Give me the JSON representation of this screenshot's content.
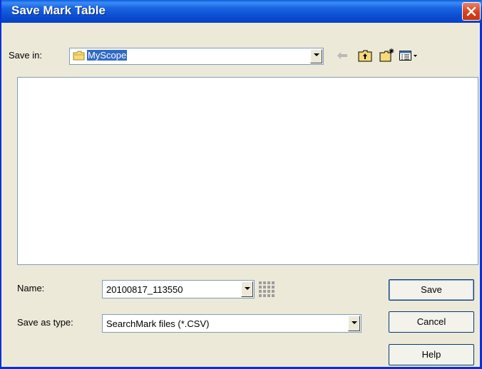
{
  "dialog": {
    "title": "Save Mark Table"
  },
  "toolbar": {
    "save_in_label": "Save in:",
    "save_in_value": "MyScope",
    "icons": [
      "back-arrow-icon",
      "up-one-level-icon",
      "new-folder-icon",
      "view-menu-icon"
    ]
  },
  "file_list": {
    "items": []
  },
  "form": {
    "name_label": "Name:",
    "name_value": "20100817_113550",
    "type_label": "Save as type:",
    "type_value": "SearchMark files (*.CSV)"
  },
  "buttons": {
    "save": "Save",
    "cancel": "Cancel",
    "help": "Help"
  },
  "colors": {
    "title_bar": "#0a4fd3",
    "dialog_bg": "#ece9d8",
    "selection": "#316ac5",
    "close": "#d9401d"
  }
}
